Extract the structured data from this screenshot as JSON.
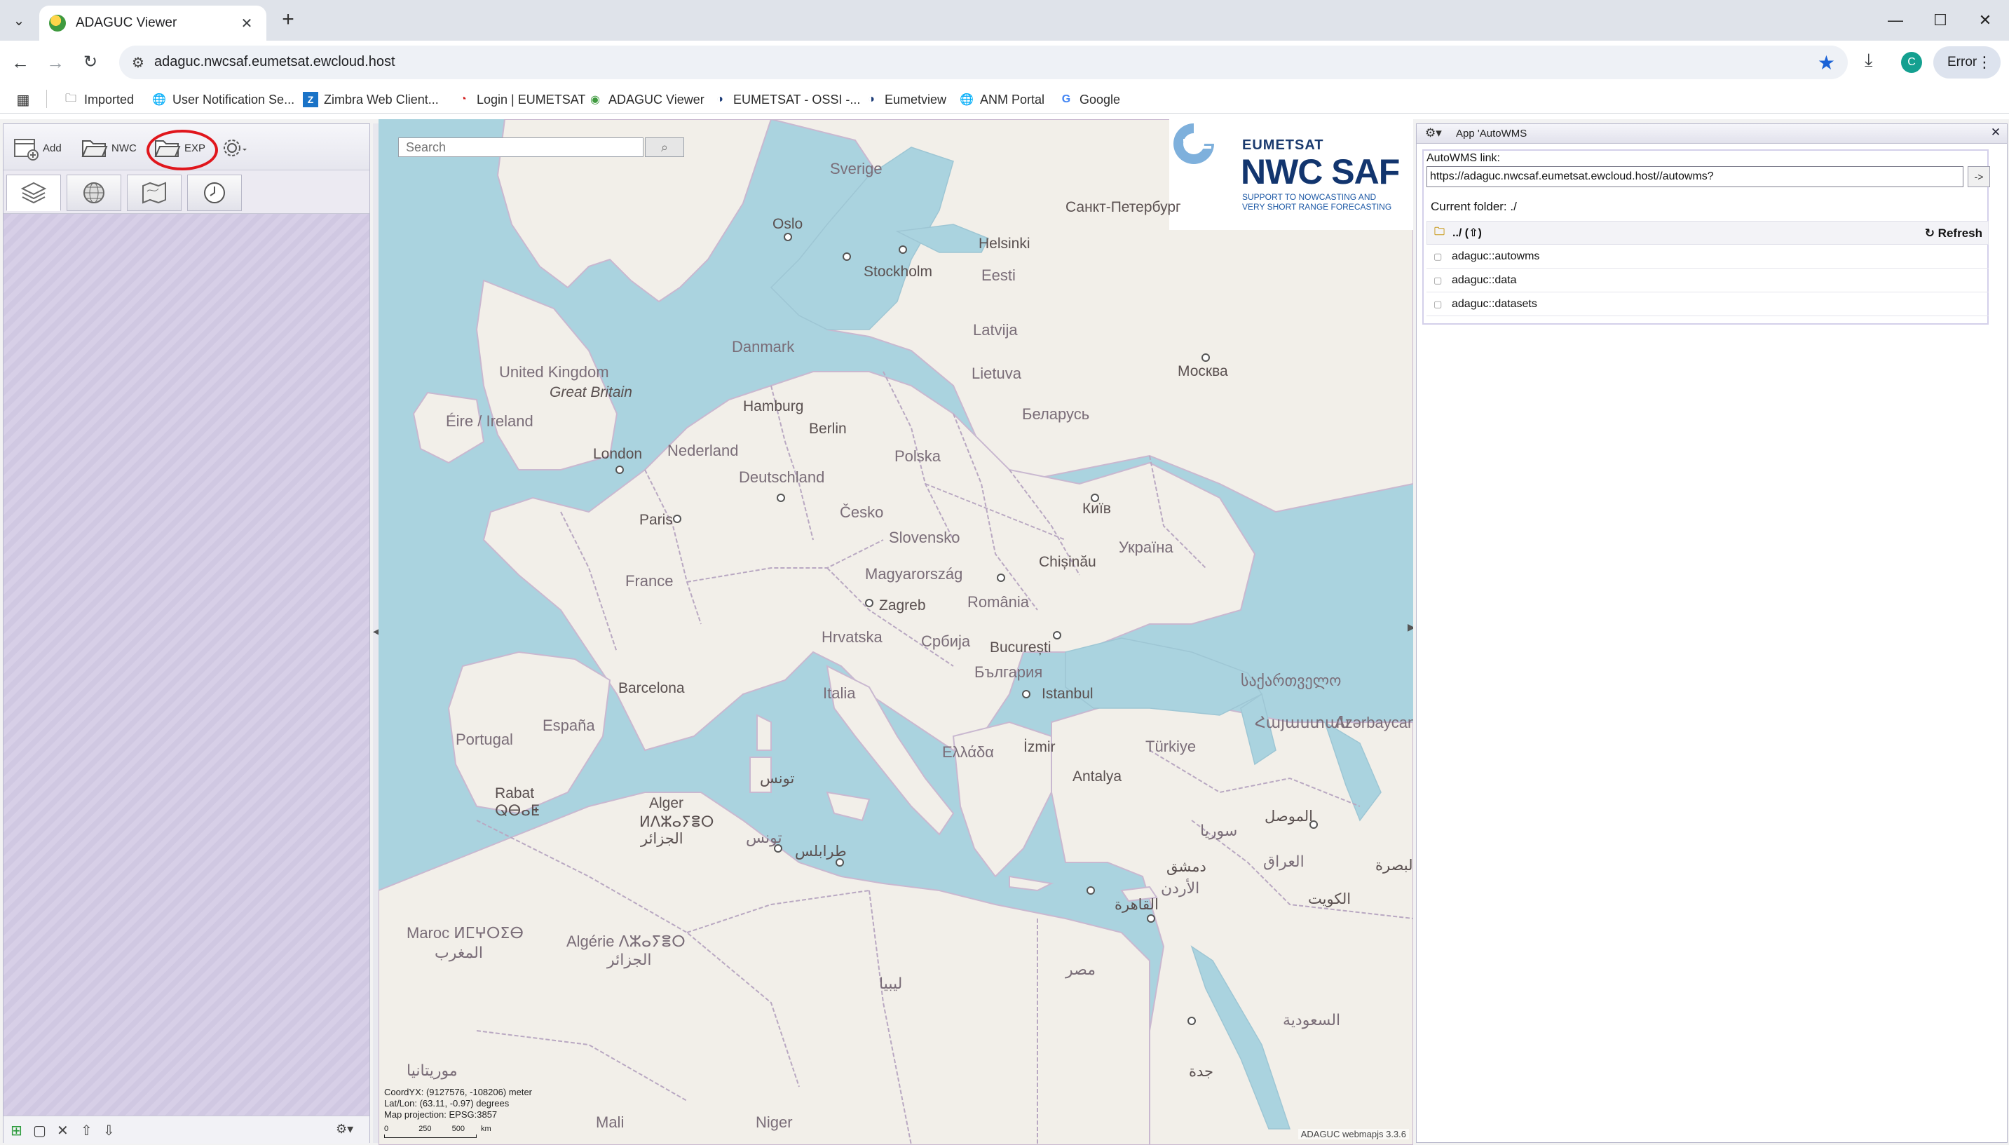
{
  "browser": {
    "tab_title": "ADAGUC Viewer",
    "url": "adaguc.nwcsaf.eumetsat.ewcloud.host",
    "error_label": "Error",
    "profile_initial": "C",
    "bookmarks": [
      {
        "label": "Imported",
        "icon": "folder-icon"
      },
      {
        "label": "User Notification Se...",
        "icon": "globe-icon"
      },
      {
        "label": "Zimbra Web Client...",
        "icon": "zimbra-icon"
      },
      {
        "label": "Login | EUMETSAT",
        "icon": "eumetsat-icon"
      },
      {
        "label": "ADAGUC Viewer",
        "icon": "adaguc-icon"
      },
      {
        "label": "EUMETSAT - OSSI -...",
        "icon": "eumetsat-icon"
      },
      {
        "label": "Eumetview",
        "icon": "eumetsat-icon"
      },
      {
        "label": "ANM Portal",
        "icon": "globe-icon"
      },
      {
        "label": "Google",
        "icon": "google-icon"
      }
    ]
  },
  "left_panel": {
    "buttons": {
      "add": "Add",
      "nwc": "NWC",
      "exp": "EXP"
    },
    "tabs": [
      "layers-icon",
      "globe-icon",
      "map-icon",
      "clock-icon"
    ]
  },
  "map": {
    "search_placeholder": "Search",
    "logo": {
      "org": "EUMETSAT",
      "product": "NWC SAF",
      "tagline_1": "SUPPORT TO NOWCASTING AND",
      "tagline_2": "VERY SHORT RANGE FORECASTING"
    },
    "labels": {
      "sverige": "Sverige",
      "oslo": "Oslo",
      "stockholm": "Stockholm",
      "helsinki": "Helsinki",
      "spb": "Санкт-Петербург",
      "eesti": "Eesti",
      "latvija": "Latvija",
      "lietuva": "Lietuva",
      "moskva": "Москва",
      "belarus": "Беларусь",
      "danmark": "Danmark",
      "uk": "United Kingdom",
      "gb": "Great Britain",
      "eire": "Éire / Ireland",
      "london": "London",
      "hamburg": "Hamburg",
      "berlin": "Berlin",
      "nederland": "Nederland",
      "deutschland": "Deutschland",
      "polska": "Polska",
      "kyiv": "Київ",
      "ukraina": "Україна",
      "paris": "Paris",
      "cesko": "Česko",
      "slovensko": "Slovensko",
      "chisinau": "Chișinău",
      "magyarorszag": "Magyarország",
      "romania": "România",
      "zagreb": "Zagreb",
      "hrvatska": "Hrvatska",
      "srbija": "Србија",
      "france": "France",
      "bucuresti": "București",
      "bulgaria": "България",
      "barcelona": "Barcelona",
      "italia": "Italia",
      "istanbul": "Istanbul",
      "georgia": "საქართველო",
      "armenia": "Հայաստան",
      "azerbaycan": "Azərbaycan",
      "espana": "España",
      "portugal": "Portugal",
      "ellada": "Ελλάδα",
      "izmir": "İzmir",
      "turkiye": "Türkiye",
      "antalya": "Antalya",
      "tunis": "تونس",
      "rabat": "Rabat",
      "rabat2": "ⵕⴱⴰⵟ",
      "alger": "Alger",
      "alger2": "ⵍⴷⵣⴰⵢⴻⵔ",
      "alger3": "الجزائر",
      "tripoli": "طرابلس",
      "mosul": "الموصل",
      "syria": "سوريا",
      "iraq": "العراق",
      "damascus": "دمشق",
      "jordan": "الأردن",
      "cairo": "القاهرة",
      "kuwait": "الكويت",
      "maroc": "Maroc ⵍⵎⵖⵔⵉⴱ",
      "maroc2": "المغرب",
      "algerie": "Algérie ⴷⵣⴰⵢⴻⵔ",
      "algerie2": "الجزائر",
      "libya": "ليبيا",
      "misr": "مصر",
      "saudi": "السعودية",
      "mauritania": "موريتانيا",
      "mali": "Mali",
      "niger": "Niger",
      "jeddah": "جدة",
      "tunisia": "تونس",
      "basra": "البصرة"
    },
    "coords": {
      "line1": "CoordYX: (9127576, -108206) meter",
      "line2": "Lat/Lon: (63.11, -0.97)  degrees",
      "line3": "Map projection: EPSG:3857"
    },
    "scale": {
      "t0": "0",
      "t1": "250",
      "t2": "500",
      "unit": "km"
    },
    "attribution": "ADAGUC webmapjs 3.3.6"
  },
  "right_panel": {
    "title": "App 'AutoWMS",
    "link_label": "AutoWMS link:",
    "link_value": "https://adaguc.nwcsaf.eumetsat.ewcloud.host//autowms?",
    "go_label": "->",
    "current_folder": "Current folder: ./",
    "parent_label": "../ (⇧)",
    "refresh_label": "↻ Refresh",
    "items": [
      "adaguc::autowms",
      "adaguc::data",
      "adaguc::datasets"
    ]
  },
  "colors": {
    "sea": "#aad3df",
    "land": "#f2efe9",
    "border": "#b9a8c2",
    "panel_bg": "#d3cbe5",
    "highlight": "#e0161c"
  }
}
